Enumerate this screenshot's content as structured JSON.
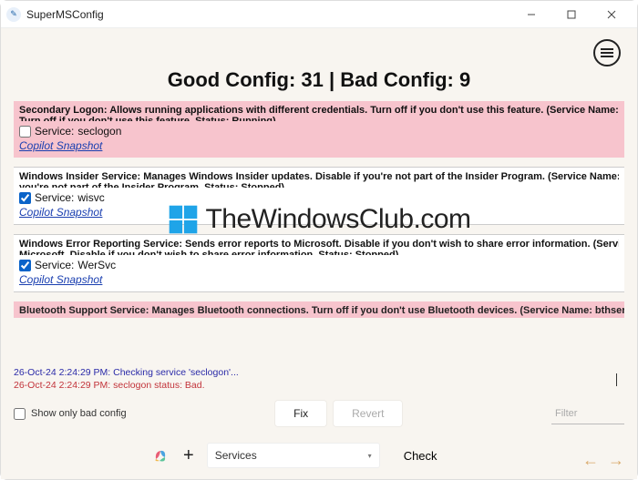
{
  "window": {
    "title": "SuperMSConfig"
  },
  "summary": {
    "text": "Good Config: 31 | Bad Config: 9"
  },
  "items": [
    {
      "status": "bad",
      "desc": "Secondary Logon: Allows running applications with different credentials. Turn off if you don't use this feature. (Service Name: s",
      "trunc": "Turn off if you don't use this feature. Status: Running)",
      "checked": false,
      "service_prefix": "Service:",
      "service_name": "seclogon",
      "snapshot_label": "Copilot Snapshot"
    },
    {
      "status": "good",
      "desc": "Windows Insider Service: Manages Windows Insider updates. Disable if you're not part of the Insider Program. (Service Name: w",
      "trunc": "you're not part of the Insider Program. Status: Stopped)",
      "checked": true,
      "service_prefix": "Service:",
      "service_name": "wisvc",
      "snapshot_label": "Copilot Snapshot"
    },
    {
      "status": "good",
      "desc": "Windows Error Reporting Service: Sends error reports to Microsoft. Disable if you don't wish to share error information. (Servic",
      "trunc": "Microsoft. Disable if you don't wish to share error information. Status: Stopped)",
      "checked": true,
      "service_prefix": "Service:",
      "service_name": "WerSvc",
      "snapshot_label": "Copilot Snapshot"
    }
  ],
  "partial_item": {
    "desc": "Bluetooth Support Service: Manages Bluetooth connections. Turn off if you don't use Bluetooth devices. (Service Name: bthserv"
  },
  "log": {
    "line1": "26-Oct-24 2:24:29 PM: Checking service 'seclogon'...",
    "line2": "26-Oct-24 2:24:29 PM: seclogon status: Bad."
  },
  "controls": {
    "show_only_bad_label": "Show only bad config",
    "fix_label": "Fix",
    "revert_label": "Revert",
    "filter_placeholder": "Filter"
  },
  "bottom": {
    "select_value": "Services",
    "check_label": "Check"
  },
  "watermark": {
    "text": "TheWindowsClub.com"
  }
}
